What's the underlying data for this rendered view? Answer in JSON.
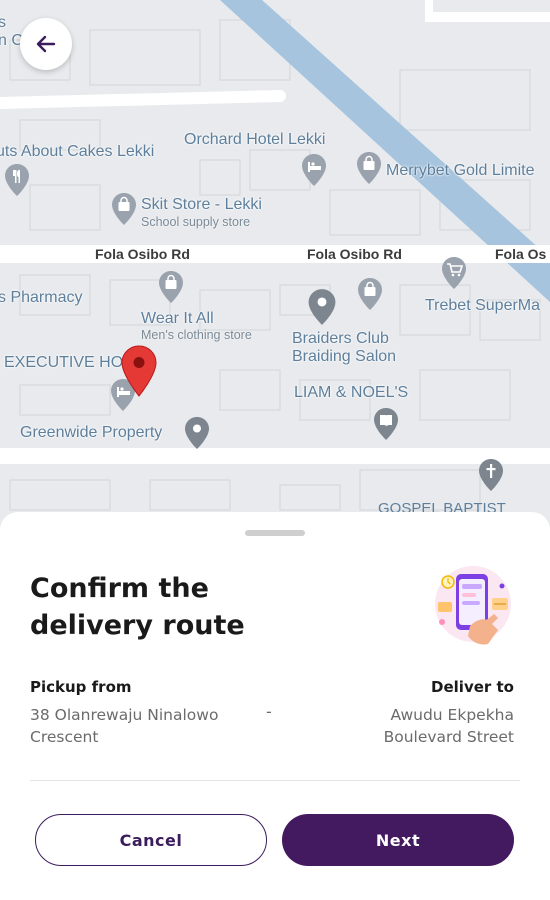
{
  "map": {
    "labels": {
      "poi_s": "s",
      "poi_n": "n C",
      "cakes": "uts About Cakes Lekki",
      "orchard": "Orchard Hotel Lekki",
      "merrybet": "Merrybet Gold Limite",
      "skit": "Skit Store - Lekki",
      "skit_sub": "School supply store",
      "road1": "Fola Osibo Rd",
      "road2": "Fola Osibo Rd",
      "road3": "Fola Os",
      "pharmacy": "s Pharmacy",
      "trebet": "Trebet SuperMa",
      "wear": "Wear It All",
      "wear_sub": "Men's clothing store",
      "braiders1": "Braiders Club",
      "braiders2": "Braiding Salon",
      "executive": "EXECUTIVE HO",
      "liam": "LIAM & NOEL'S",
      "greenwide": "Greenwide Property",
      "gospel": "GOSPEL BAPTIST"
    },
    "back_icon": "arrow-left-icon",
    "marker_icon": "location-pin-icon",
    "colors": {
      "river": "#a7c4de",
      "road": "#ffffff",
      "land": "#e8eaed",
      "marker": "#e53935"
    }
  },
  "sheet": {
    "title": "Confirm the delivery route",
    "pickup_label": "Pickup from",
    "pickup_address": "38 Olanrewaju Ninalowo Crescent",
    "separator": "-",
    "deliver_label": "Deliver to",
    "deliver_address": "Awudu Ekpekha Boulevard Street",
    "illustration_icon": "phone-delivery-illustration",
    "cancel_label": "Cancel",
    "next_label": "Next"
  },
  "colors": {
    "primary": "#43195f",
    "text": "#1a1a1a",
    "muted": "#6b6b6b"
  }
}
